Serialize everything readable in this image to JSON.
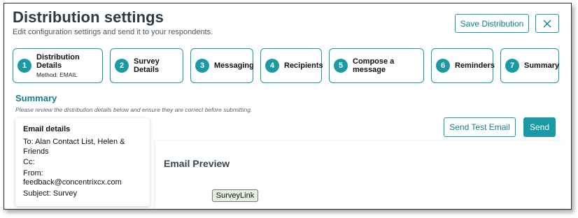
{
  "header": {
    "title": "Distribution settings",
    "subtitle": "Edit configuration settings and send it to your respondents.",
    "save_label": "Save Distribution",
    "close_icon": "close-icon"
  },
  "steps": [
    {
      "number": "1",
      "label": "Distribution Details",
      "sub": "Method: EMAIL"
    },
    {
      "number": "2",
      "label": "Survey Details",
      "sub": ""
    },
    {
      "number": "3",
      "label": "Messaging",
      "sub": ""
    },
    {
      "number": "4",
      "label": "Recipients",
      "sub": ""
    },
    {
      "number": "5",
      "label": "Compose a message",
      "sub": ""
    },
    {
      "number": "6",
      "label": "Reminders",
      "sub": ""
    },
    {
      "number": "7",
      "label": "Summary",
      "sub": ""
    }
  ],
  "summary": {
    "heading": "Summary",
    "note": "Please review the distribution details below and ensure they are correct before submitting."
  },
  "email_details": {
    "title": "Email details",
    "to": "To: Alan Contact List, Helen & Friends",
    "cc": "Cc:",
    "from": "From: feedback@concentrixcx.com",
    "subject": "Subject: Survey"
  },
  "actions": {
    "test_email_label": "Send Test Email",
    "send_label": "Send"
  },
  "preview": {
    "label": "Email Preview",
    "survey_link_label": "SurveyLink"
  },
  "colors": {
    "accent": "#1a9aa5",
    "accent_text": "#11808b"
  }
}
